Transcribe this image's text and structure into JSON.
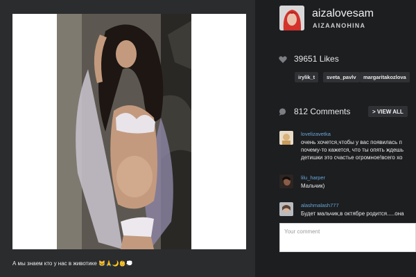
{
  "post": {
    "caption": "А мы знаем кто у нас в животике 😸🙏🌙👶💭"
  },
  "profile": {
    "username": "aizalovesam",
    "full_name": "AIZAANOHINA"
  },
  "likes": {
    "count_label": "39651 Likes",
    "likers": [
      "irylik_t",
      "sveta_pavlv",
      "margaritakozlova"
    ]
  },
  "comments": {
    "count_label": "812 Comments",
    "view_all_label": "> VIEW ALL",
    "items": [
      {
        "author": "lovelizavetka",
        "lines": [
          "очень хочется,чтобы у вас появилась п",
          "почему-то кажется, что ты опять ждешь",
          "детишки это счастье огромное!всего хо"
        ]
      },
      {
        "author": "lilu_harper",
        "lines": [
          "Мальчик)"
        ]
      },
      {
        "author": "alashmalash777",
        "lines": [
          "Будет мальчик,в октябре родится.....она"
        ]
      }
    ],
    "input_placeholder": "Your comment"
  },
  "colors": {
    "background": "#1c1e20",
    "left_panel": "#2a2c2e",
    "tag_background": "#2f3134",
    "author_link": "#6aa7d8"
  }
}
